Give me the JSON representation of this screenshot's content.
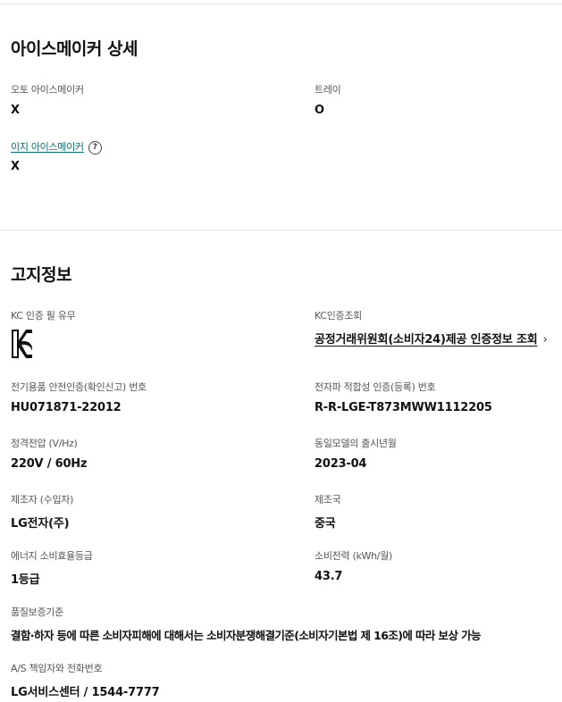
{
  "icemaker": {
    "title": "아이스메이커 상세",
    "auto_label": "오토 아이스메이커",
    "auto_value": "X",
    "tray_label": "트레이",
    "tray_value": "O",
    "easy_label": "이지 아이스메이커",
    "easy_help_icon": "question-circle-icon",
    "easy_help_glyph": "?",
    "easy_value": "X"
  },
  "notice": {
    "title": "고지정보",
    "kc_mark_label": "KC 인증 필 유무",
    "kc_mark_icon": "kc-certification-mark",
    "kc_lookup_label": "KC인증조회",
    "kc_lookup_link": "공정거래위원회(소비자24)제공 인증정보 조회",
    "kc_lookup_chevron": "›",
    "safety_cert_label": "전기용품 안전인증(확인신고) 번호",
    "safety_cert_value": "HU071871-22012",
    "emc_label": "전자파 적합성 인증(등록) 번호",
    "emc_value": "R-R-LGE-T873MWW1112205",
    "voltage_label": "정격전압 (V/Hz)",
    "voltage_value": "220V / 60Hz",
    "release_label": "동일모델의 출시년월",
    "release_value": "2023-04",
    "maker_label": "제조자 (수입자)",
    "maker_value": "LG전자(주)",
    "country_label": "제조국",
    "country_value": "중국",
    "energy_label": "에너지 소비효율등급",
    "energy_value": "1등급",
    "power_label": "소비전력 (kWh/월)",
    "power_value": "43.7",
    "quality_label": "품질보증기준",
    "quality_value": "결함·하자 등에 따른 소비자피해에 대해서는 소비자분쟁해결기준(소비자기본법 제 16조)에 따라 보상 가능",
    "as_label": "A/S 책임자와 전화번호",
    "as_value": "LG서비스센터 / 1544-7777"
  },
  "colors": {
    "link_teal": "#0b6e73",
    "divider": "#e3e3e3"
  }
}
